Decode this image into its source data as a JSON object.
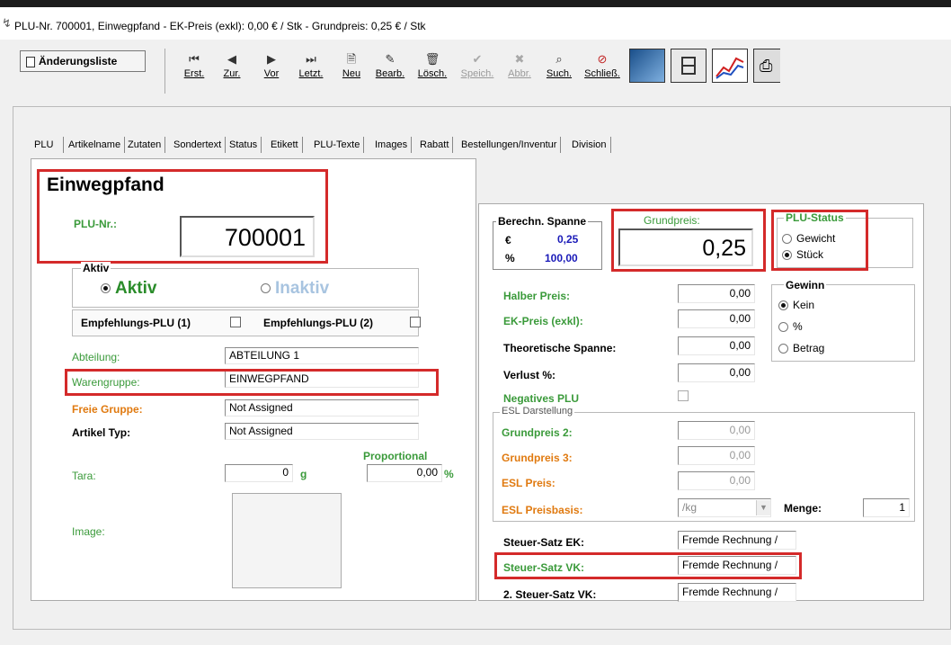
{
  "window": {
    "title": "PLU-Nr. 700001, Einwegpfand - EK-Preis (exkl): 0,00 € / Stk - Grundpreis: 0,25 € / Stk"
  },
  "toolbar": {
    "changelist": "Änderungsliste",
    "first": "Erst.",
    "prev": "Zur.",
    "next": "Vor",
    "last": "Letzt.",
    "new": "Neu",
    "edit": "Bearb.",
    "delete": "Lösch.",
    "save": "Speich.",
    "cancel": "Abbr.",
    "search": "Such.",
    "close": "Schließ."
  },
  "tabs": [
    "PLU",
    "Artikelname",
    "Zutaten",
    "Sondertext",
    "Status",
    "Etikett",
    "PLU-Texte",
    "Images",
    "Rabatt",
    "Bestellungen/Inventur",
    "Division"
  ],
  "article": {
    "name": "Einwegpfand",
    "plu_label": "PLU-Nr.:",
    "plu_value": "700001",
    "aktiv_group": "Aktiv",
    "aktiv": "Aktiv",
    "inaktiv": "Inaktiv",
    "emp1": "Empfehlungs-PLU (1)",
    "emp2": "Empfehlungs-PLU (2)",
    "abteilung_label": "Abteilung:",
    "abteilung": "ABTEILUNG 1",
    "warengruppe_label": "Warengruppe:",
    "warengruppe": "EINWEGPFAND",
    "freie_label": "Freie Gruppe:",
    "freie": "Not Assigned",
    "typ_label": "Artikel Typ:",
    "typ": "Not Assigned",
    "tara_label": "Tara:",
    "tara": "0",
    "tara_unit": "g",
    "prop_label": "Proportional",
    "prop": "0,00",
    "prop_unit": "%",
    "image_label": "Image:"
  },
  "pricing": {
    "spanne_title": "Berechn. Spanne",
    "eur_sym": "€",
    "eur_val": "0,25",
    "pct_sym": "%",
    "pct_val": "100,00",
    "grund_label": "Grundpreis:",
    "grund_value": "0,25",
    "status_title": "PLU-Status",
    "gewicht": "Gewicht",
    "stueck": "Stück",
    "halber_label": "Halber Preis:",
    "halber": "0,00",
    "ek_label": "EK-Preis (exkl):",
    "ek": "0,00",
    "theo_label": "Theoretische Spanne:",
    "theo": "0,00",
    "verlust_label": "Verlust %:",
    "verlust": "0,00",
    "neg_label": "Negatives PLU",
    "gewinn_title": "Gewinn",
    "kein": "Kein",
    "pct": "%",
    "betrag": "Betrag",
    "esl_title": "ESL Darstellung",
    "gp2_label": "Grundpreis 2:",
    "gp2": "0,00",
    "gp3_label": "Grundpreis 3:",
    "gp3": "0,00",
    "eslp_label": "ESL Preis:",
    "eslp": "0,00",
    "eslb_label": "ESL Preisbasis:",
    "eslb": "/kg",
    "menge_label": "Menge:",
    "menge": "1",
    "stek_label": "Steuer-Satz EK:",
    "stek": "Fremde Rechnung /",
    "stvk_label": "Steuer-Satz VK:",
    "stvk": "Fremde Rechnung /",
    "st2_label": "2. Steuer-Satz VK:",
    "st2": "Fremde Rechnung /"
  }
}
